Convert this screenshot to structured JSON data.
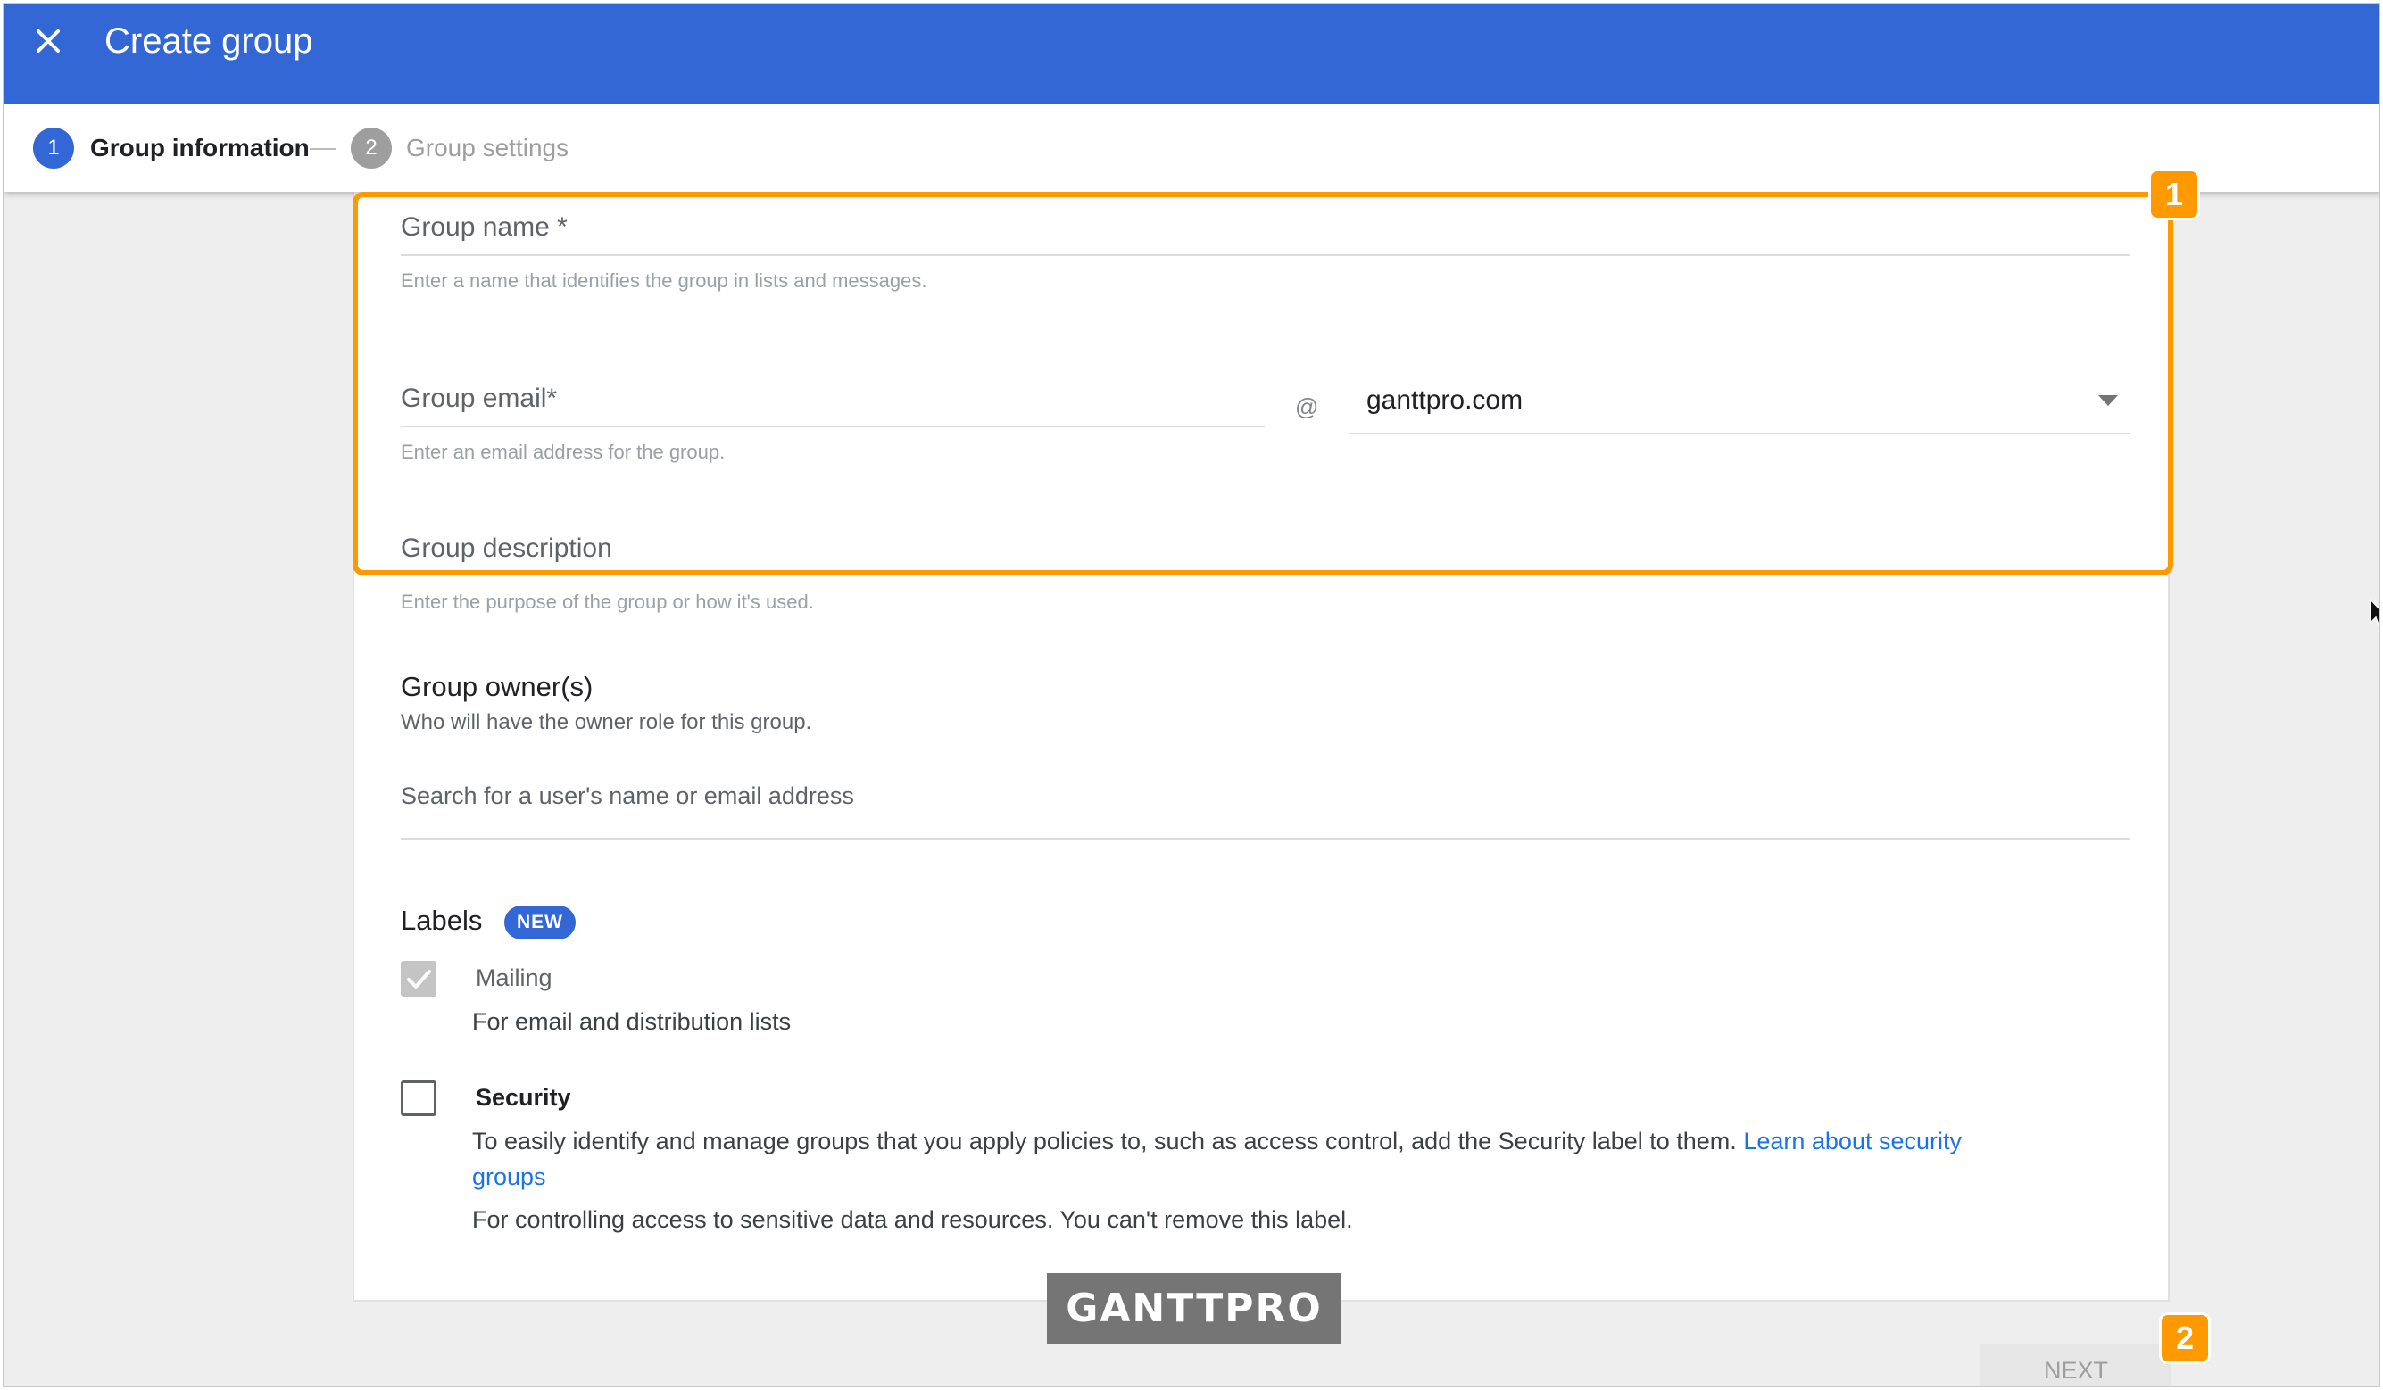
{
  "header": {
    "title": "Create group",
    "close_icon": "close-icon",
    "background": "#3367d6"
  },
  "stepper": {
    "steps": [
      {
        "number": "1",
        "label": "Group information",
        "state": "active"
      },
      {
        "number": "2",
        "label": "Group settings",
        "state": "inactive"
      }
    ]
  },
  "form": {
    "group_name": {
      "label": "Group name *",
      "hint": "Enter a name that identifies the group in lists and messages."
    },
    "group_email": {
      "label": "Group email*",
      "at": "@",
      "domain": "ganttpro.com",
      "hint": "Enter an email address for the group."
    },
    "group_description": {
      "label": "Group description",
      "hint": "Enter the purpose of the group or how it's used."
    }
  },
  "owners": {
    "title": "Group owner(s)",
    "subtitle": "Who will have the owner role for this group.",
    "search_placeholder": "Search for a user's name or email address"
  },
  "labels": {
    "title": "Labels",
    "badge": "NEW",
    "mailing": {
      "name": "Mailing",
      "checked": true,
      "description": "For email and distribution lists"
    },
    "security": {
      "name": "Security",
      "checked": false,
      "description": "To easily identify and manage groups that you apply policies to, such as access control, add the Security label to them.",
      "link_text_1": "Learn about security",
      "link_text_2": "groups",
      "note": "For controlling access to sensitive data and resources. You can't remove this label."
    }
  },
  "footer": {
    "next_label": "NEXT"
  },
  "annotations": {
    "callout_1": "1",
    "callout_2": "2",
    "highlight_color": "#ff9900"
  },
  "watermark": {
    "text": "GANTTPRO"
  }
}
